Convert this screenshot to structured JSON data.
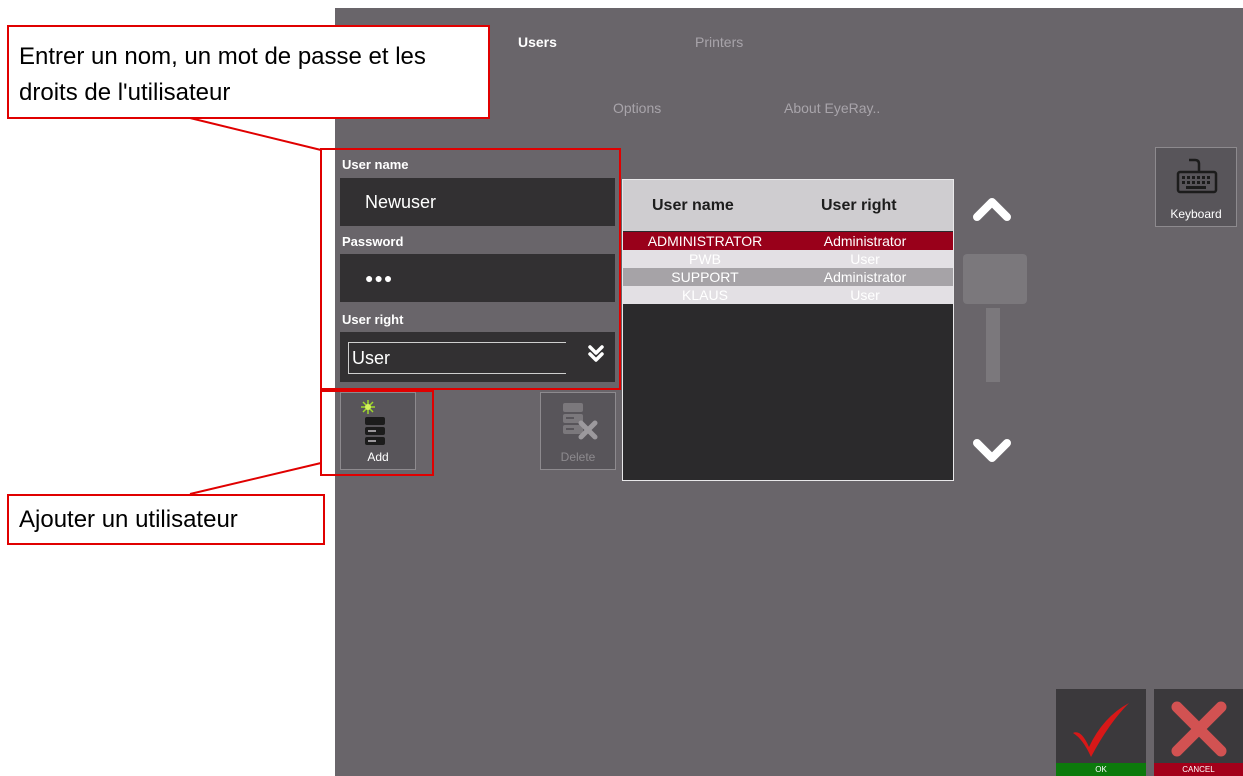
{
  "nav": {
    "users": "Users",
    "printers": "Printers",
    "options": "Options",
    "about": "About EyeRay.."
  },
  "form": {
    "username_label": "User name",
    "username_value": "Newuser",
    "password_label": "Password",
    "password_value": "●●●",
    "right_label": "User right",
    "right_value": "User"
  },
  "buttons": {
    "add": "Add",
    "delete": "Delete",
    "keyboard": "Keyboard",
    "ok": "OK",
    "cancel": "CANCEL"
  },
  "table": {
    "col_name": "User name",
    "col_right": "User right",
    "rows": [
      {
        "name": "ADMINISTRATOR",
        "right": "Administrator"
      },
      {
        "name": "PWB",
        "right": "User"
      },
      {
        "name": "SUPPORT",
        "right": "Administrator"
      },
      {
        "name": "KLAUS",
        "right": "User"
      }
    ]
  },
  "callouts": {
    "top": "Entrer un nom, un mot de passe et les droits de l'utilisateur",
    "bottom": "Ajouter un utilisateur"
  },
  "colors": {
    "selected_row": "#99001a",
    "ok_green": "#0c7a0c",
    "cancel_red": "#a3001a",
    "annotation_red": "#e00000"
  }
}
